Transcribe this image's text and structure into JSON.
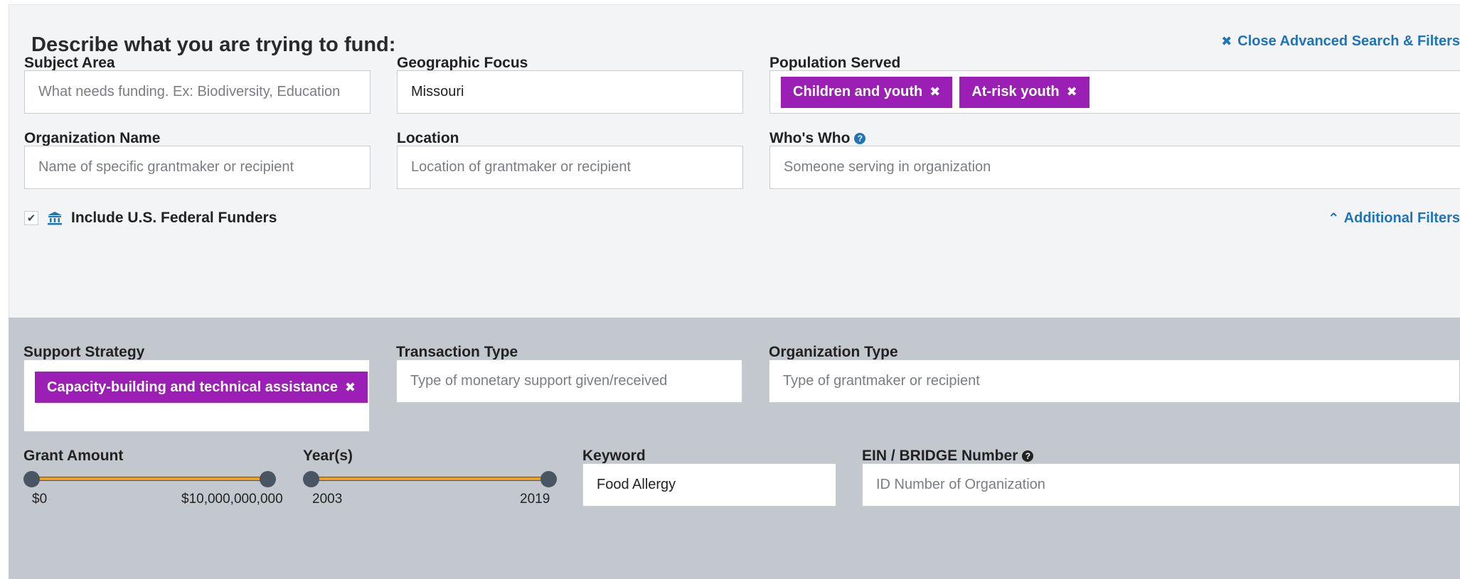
{
  "header": {
    "title": "Describe what you are trying to fund:",
    "close_icon": "x-icon",
    "close_label": "Close Advanced Search & Filters"
  },
  "fields": {
    "subject_area": {
      "label": "Subject Area",
      "placeholder": "What needs funding. Ex: Biodiversity, Education"
    },
    "geographic_focus": {
      "label": "Geographic Focus",
      "value": "Missouri"
    },
    "population_served": {
      "label": "Population Served",
      "tags": [
        "Children and youth",
        "At-risk youth"
      ]
    },
    "organization_name": {
      "label": "Organization Name",
      "placeholder": "Name of specific grantmaker or recipient"
    },
    "location": {
      "label": "Location",
      "placeholder": "Location of grantmaker or recipient"
    },
    "whos_who": {
      "label": "Who's Who",
      "help_icon": "question-circle-icon",
      "placeholder": "Someone serving in organization"
    }
  },
  "federal": {
    "checked": true,
    "icon": "bank-icon",
    "label": "Include U.S. Federal Funders"
  },
  "additional_filters": {
    "icon": "chevron-up-icon",
    "label": "Additional Filters"
  },
  "advanced": {
    "support_strategy": {
      "label": "Support Strategy",
      "tags": [
        "Capacity-building and technical assistance"
      ]
    },
    "transaction_type": {
      "label": "Transaction Type",
      "placeholder": "Type of monetary support given/received"
    },
    "organization_type": {
      "label": "Organization Type",
      "placeholder": "Type of grantmaker or recipient"
    },
    "grant_amount": {
      "label": "Grant Amount",
      "min": "$0",
      "max": "$10,000,000,000"
    },
    "years": {
      "label": "Year(s)",
      "min": "2003",
      "max": "2019"
    },
    "keyword": {
      "label": "Keyword",
      "value": "Food Allergy"
    },
    "ein": {
      "label": "EIN / BRIDGE Number",
      "help_icon": "question-circle-icon",
      "placeholder": "ID Number of Organization"
    }
  },
  "colors": {
    "accent_blue": "#1f73b7",
    "tag_purple": "#9c1fb5",
    "slider_orange": "#f0a020",
    "panel_light": "#f3f4f6",
    "panel_gray": "#c3c8cf"
  }
}
